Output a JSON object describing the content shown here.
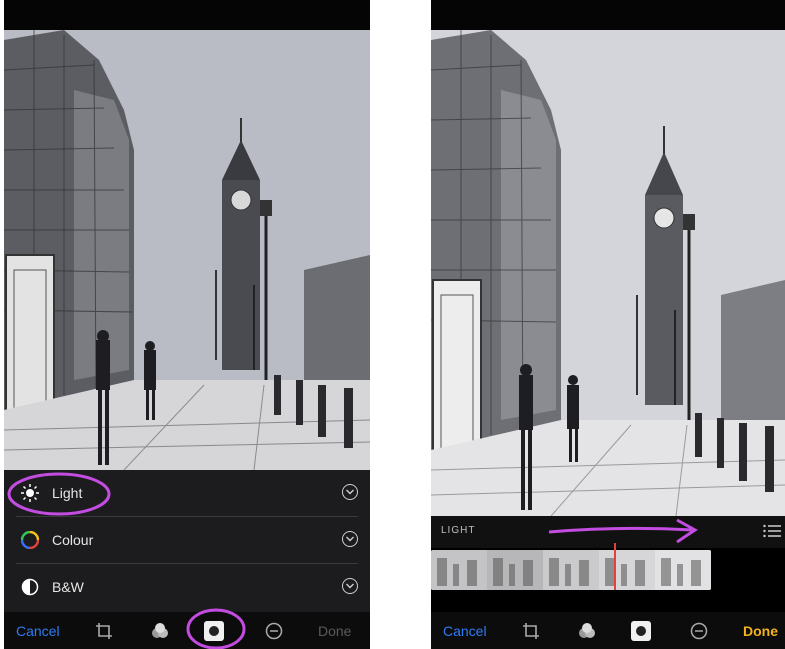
{
  "left_panel": {
    "menu": [
      {
        "label": "Light",
        "icon": "sun-icon"
      },
      {
        "label": "Colour",
        "icon": "color-wheel-icon"
      },
      {
        "label": "B&W",
        "icon": "half-circle-icon"
      }
    ],
    "cancel": "Cancel",
    "done": "Done"
  },
  "right_panel": {
    "section_label": "LIGHT",
    "cancel": "Cancel",
    "done": "Done"
  },
  "colors": {
    "accent_blue": "#2e7cf6",
    "done_gold": "#f2b21b",
    "annotation_purple": "#c24de0",
    "playhead_red": "#e0433a"
  }
}
